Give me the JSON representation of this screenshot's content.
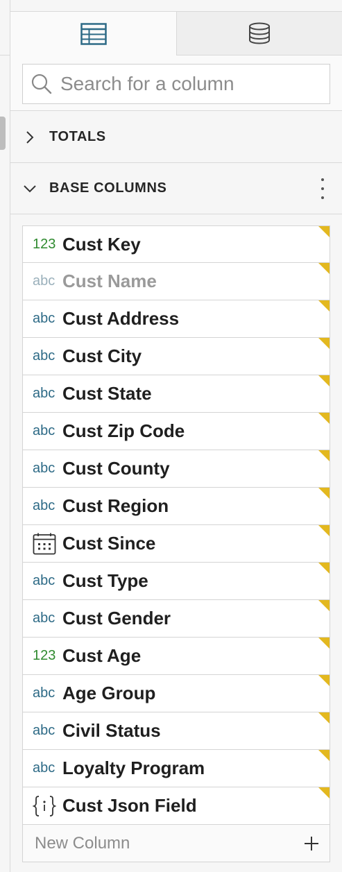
{
  "tabs": [
    {
      "icon": "table-icon",
      "active": true
    },
    {
      "icon": "database-icon",
      "active": false
    }
  ],
  "search": {
    "placeholder": "Search for a column",
    "value": ""
  },
  "sections": {
    "totals": {
      "label": "TOTALS",
      "expanded": false
    },
    "base": {
      "label": "BASE COLUMNS",
      "expanded": true
    }
  },
  "columns": [
    {
      "type": "number",
      "type_label": "123",
      "name": "Cust Key",
      "dimmed": false
    },
    {
      "type": "text",
      "type_label": "abc",
      "name": "Cust Name",
      "dimmed": true
    },
    {
      "type": "text",
      "type_label": "abc",
      "name": "Cust Address",
      "dimmed": false
    },
    {
      "type": "text",
      "type_label": "abc",
      "name": "Cust City",
      "dimmed": false
    },
    {
      "type": "text",
      "type_label": "abc",
      "name": "Cust State",
      "dimmed": false
    },
    {
      "type": "text",
      "type_label": "abc",
      "name": "Cust Zip Code",
      "dimmed": false
    },
    {
      "type": "text",
      "type_label": "abc",
      "name": "Cust County",
      "dimmed": false
    },
    {
      "type": "text",
      "type_label": "abc",
      "name": "Cust Region",
      "dimmed": false
    },
    {
      "type": "date",
      "type_label": "",
      "name": "Cust Since",
      "dimmed": false
    },
    {
      "type": "text",
      "type_label": "abc",
      "name": "Cust Type",
      "dimmed": false
    },
    {
      "type": "text",
      "type_label": "abc",
      "name": "Cust Gender",
      "dimmed": false
    },
    {
      "type": "number",
      "type_label": "123",
      "name": "Cust Age",
      "dimmed": false
    },
    {
      "type": "text",
      "type_label": "abc",
      "name": "Age Group",
      "dimmed": false
    },
    {
      "type": "text",
      "type_label": "abc",
      "name": "Civil Status",
      "dimmed": false
    },
    {
      "type": "text",
      "type_label": "abc",
      "name": "Loyalty Program",
      "dimmed": false
    },
    {
      "type": "json",
      "type_label": "",
      "name": "Cust Json Field",
      "dimmed": false
    }
  ],
  "new_column": {
    "label": "New Column"
  },
  "colors": {
    "accent": "#2d6a86",
    "number_type": "#2f8a2f",
    "corner_flag": "#e3b81f"
  }
}
